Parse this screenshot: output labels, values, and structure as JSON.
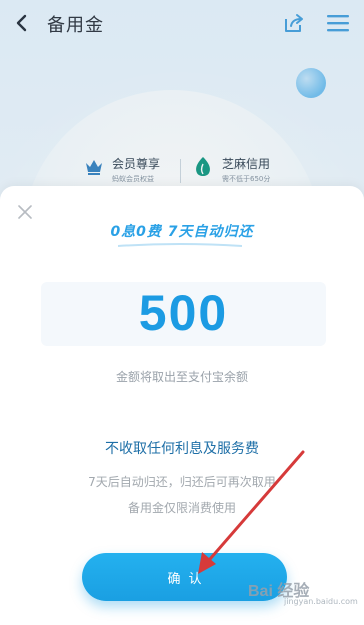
{
  "header": {
    "title": "备用金"
  },
  "benefits": [
    {
      "title": "会员尊享",
      "subtitle": "蚂蚁会员权益",
      "icon": "crown-icon"
    },
    {
      "title": "芝麻信用",
      "subtitle": "需不低于650分",
      "icon": "leaf-icon"
    }
  ],
  "sheet": {
    "slogan": "0息0费  7天自动归还",
    "amount": "500",
    "amount_note": "金额将取出至支付宝余额",
    "free_title": "不收取任何利息及服务费",
    "free_line1": "7天后自动归还，归还后可再次取用",
    "free_line2": "备用金仅限消费使用",
    "confirm_label": "确认"
  },
  "watermark": {
    "logo": "Bai  经验",
    "sub": "jingyan.baidu.com"
  },
  "colors": {
    "accent": "#1c9be3",
    "arrow": "#d63a3a"
  }
}
